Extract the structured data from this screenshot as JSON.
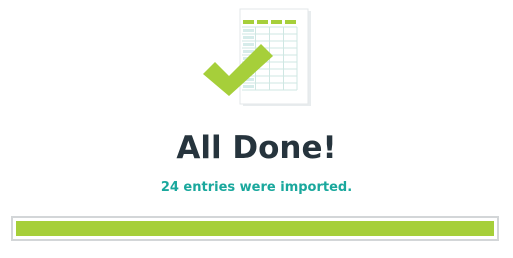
{
  "dialog": {
    "title": "All Done!",
    "message": "24 entries were imported."
  },
  "progress": {
    "fraction": 1.0
  },
  "icons": {
    "illustration": "spreadsheet-with-checkmark-icon"
  },
  "colors": {
    "accent": "#a6cf3a",
    "title": "#26343d",
    "message": "#1aa89d",
    "border": "#d3d6d8"
  }
}
